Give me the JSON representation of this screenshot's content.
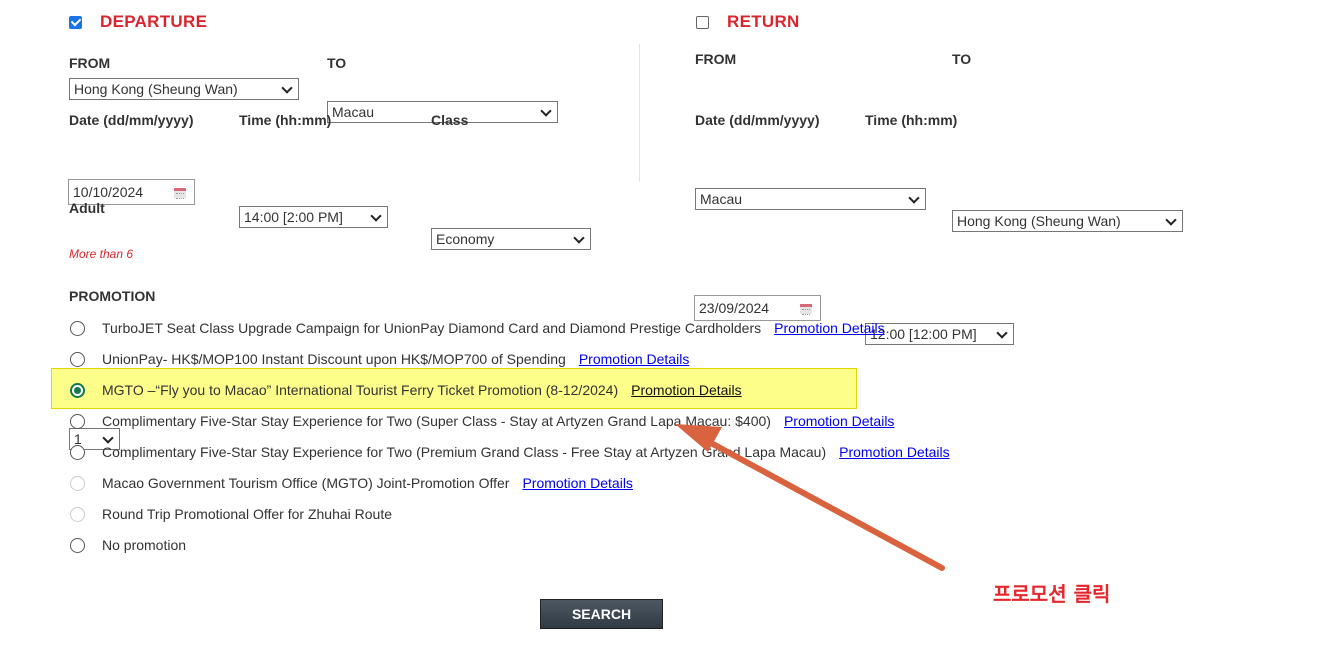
{
  "departure": {
    "title": "DEPARTURE",
    "checked": true,
    "from_label": "FROM",
    "from_value": "Hong Kong (Sheung Wan)",
    "to_label": "TO",
    "to_value": "Macau",
    "date_label": "Date (dd/mm/yyyy)",
    "date_value": "10/10/2024",
    "time_label": "Time (hh:mm)",
    "time_value": "14:00 [2:00 PM]",
    "class_label": "Class",
    "class_value": "Economy"
  },
  "return": {
    "title": "RETURN",
    "checked": false,
    "from_label": "FROM",
    "from_value": "Macau",
    "to_label": "TO",
    "to_value": "Hong Kong (Sheung Wan)",
    "date_label": "Date (dd/mm/yyyy)",
    "date_value": "23/09/2024",
    "time_label": "Time (hh:mm)",
    "time_value": "12:00 [12:00 PM]"
  },
  "passengers": {
    "adult_label": "Adult",
    "adult_value": "1",
    "more_note": "More than 6"
  },
  "promotion": {
    "heading": "PROMOTION",
    "selected_index": 2,
    "options": [
      {
        "text": "TurboJET Seat Class Upgrade Campaign for UnionPay Diamond Card and Diamond Prestige Cardholders",
        "link": "Promotion Details",
        "enabled": true
      },
      {
        "text": "UnionPay- HK$/MOP100 Instant Discount upon HK$/MOP700 of Spending",
        "link": "Promotion Details",
        "enabled": true
      },
      {
        "text": "MGTO –“Fly you to Macao” International Tourist Ferry Ticket Promotion (8-12/2024)",
        "link": "Promotion Details",
        "enabled": true
      },
      {
        "text": "Complimentary Five-Star Stay Experience for Two (Super Class - Stay at Artyzen Grand Lapa Macau: $400)",
        "link": "Promotion Details",
        "enabled": true
      },
      {
        "text": "Complimentary Five-Star Stay Experience for Two (Premium Grand Class - Free Stay at Artyzen Grand Lapa Macau)",
        "link": "Promotion Details",
        "enabled": true
      },
      {
        "text": "Macao Government Tourism Office (MGTO) Joint-Promotion Offer",
        "link": "Promotion Details",
        "enabled": false
      },
      {
        "text": "Round Trip Promotional Offer for Zhuhai Route",
        "link": "",
        "enabled": false
      },
      {
        "text": "No promotion",
        "link": "",
        "enabled": true
      }
    ]
  },
  "search_button": "SEARCH",
  "annotation": {
    "text": "프로모션 클릭",
    "color": "#e5262c",
    "arrow_color": "#d9623f"
  },
  "colors": {
    "heading_red": "#d9262e",
    "link_blue": "#0000ee",
    "highlight": "#fdfd8a",
    "radio_selected": "#11794a"
  }
}
